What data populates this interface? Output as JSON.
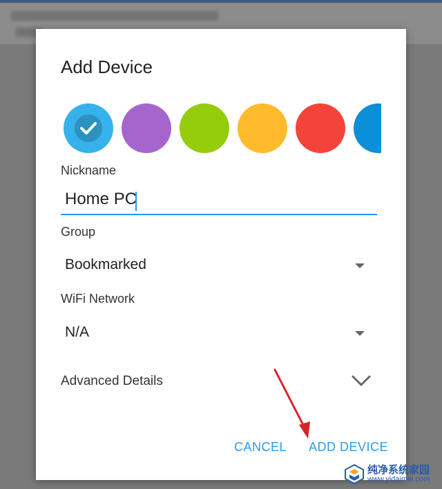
{
  "dialog": {
    "title": "Add Device",
    "colors": [
      {
        "name": "blue",
        "hex": "#36b1ea",
        "selected": true
      },
      {
        "name": "purple",
        "hex": "#a665cd",
        "selected": false
      },
      {
        "name": "green",
        "hex": "#95cc0c",
        "selected": false
      },
      {
        "name": "orange",
        "hex": "#ffbb2c",
        "selected": false
      },
      {
        "name": "red",
        "hex": "#f4433a",
        "selected": false
      },
      {
        "name": "dark-blue",
        "hex": "#0b8fd6",
        "selected": false
      }
    ],
    "nickname": {
      "label": "Nickname",
      "value": "Home PC"
    },
    "group": {
      "label": "Group",
      "value": "Bookmarked"
    },
    "wifi": {
      "label": "WiFi Network",
      "value": "N/A"
    },
    "advanced": {
      "label": "Advanced Details",
      "icon": "chevron-down-icon"
    },
    "buttons": {
      "cancel": "CANCEL",
      "add": "ADD DEVICE"
    },
    "accent": "#2196f3",
    "button_color": "#2b9af3"
  },
  "watermark": {
    "text": "纯净系统家园",
    "url": "www.yidaimei.com"
  }
}
